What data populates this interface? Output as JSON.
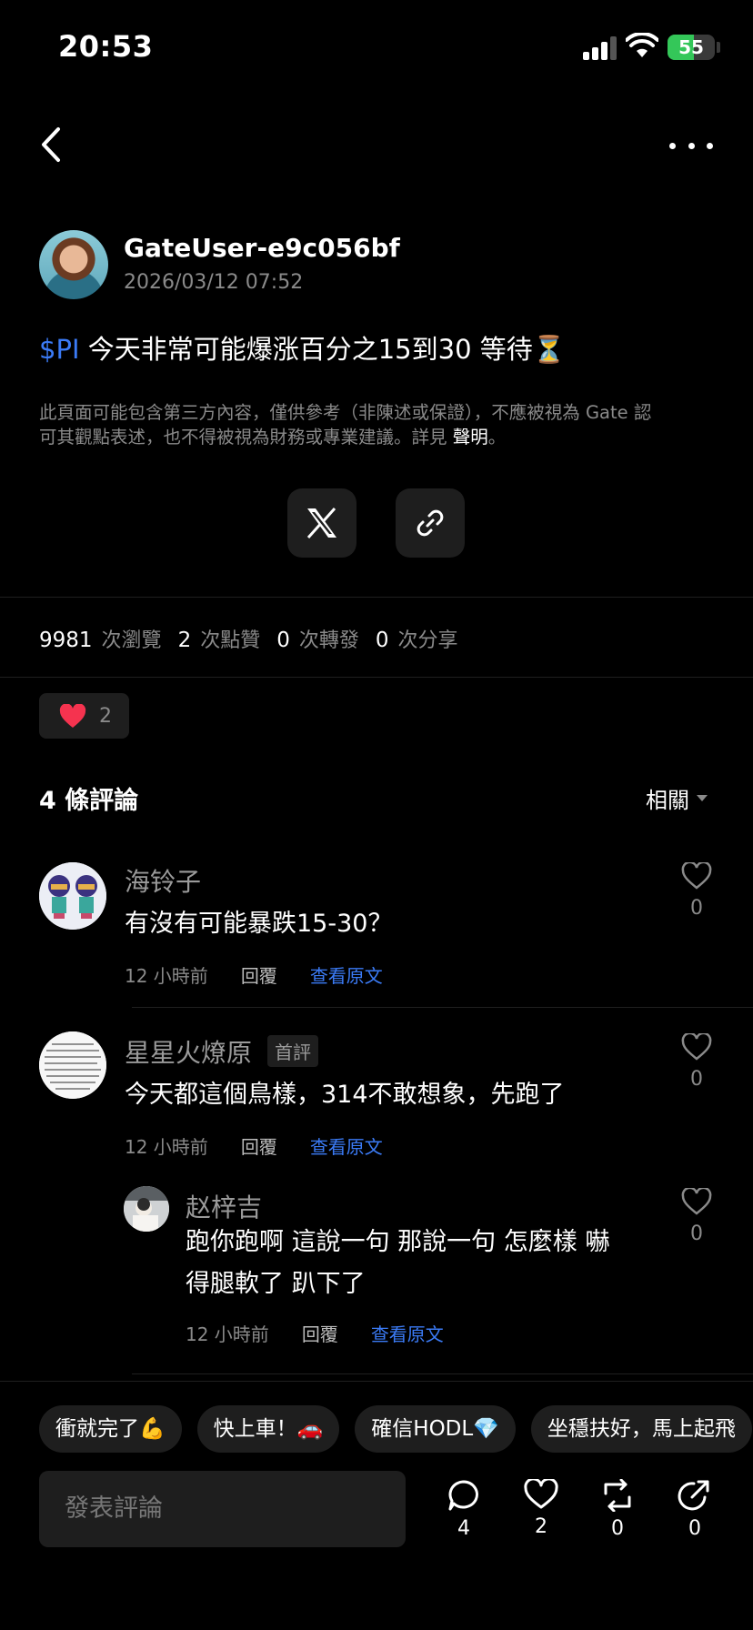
{
  "status_bar": {
    "time": "20:53",
    "battery": "55",
    "battery_level": 0.55
  },
  "post": {
    "author": "GateUser-e9c056bf",
    "timestamp": "2026/03/12 07:52",
    "ticker": "$PI",
    "text": " 今天非常可能爆涨百分之15到30 等待⏳",
    "disclaimer_line1": "此頁面可能包含第三方內容，僅供參考（非陳述或保證），不應被視為 Gate 認",
    "disclaimer_line2": "可其觀點表述，也不得被視為財務或專業建議。詳見 ",
    "disclaimer_link": "聲明",
    "disclaimer_end": "。"
  },
  "stats": {
    "views": "9981",
    "views_label": "次瀏覽",
    "likes": "2",
    "likes_label": "次點贊",
    "reposts": "0",
    "reposts_label": "次轉發",
    "shares": "0",
    "shares_label": "次分享"
  },
  "reaction": {
    "count": "2"
  },
  "comments_header": {
    "title": "4 條評論",
    "sort": "相關"
  },
  "comments": [
    {
      "name": "海铃子",
      "text": "有沒有可能暴跌15-30？",
      "time": "12 小時前",
      "reply": "回覆",
      "original": "查看原文",
      "likes": "0"
    },
    {
      "name": "星星火燎原",
      "badge": "首評",
      "text": "今天都這個鳥樣，314不敢想象，先跑了",
      "time": "12 小時前",
      "reply": "回覆",
      "original": "查看原文",
      "likes": "0"
    },
    {
      "name": "赵梓吉",
      "text_line1": "跑你跑啊 這說一句 那說一句 怎麼樣 嚇",
      "text_line2": "得腿軟了 趴下了",
      "time": "12 小時前",
      "reply": "回覆",
      "original": "查看原文",
      "likes": "0"
    }
  ],
  "quick_replies": [
    "衝就完了💪",
    "快上車！🚗",
    "確信HODL💎",
    "坐穩扶好，馬上起飛"
  ],
  "bottom_bar": {
    "input_placeholder": "發表評論",
    "comments": "4",
    "likes": "2",
    "reposts": "0",
    "shares": "0"
  }
}
